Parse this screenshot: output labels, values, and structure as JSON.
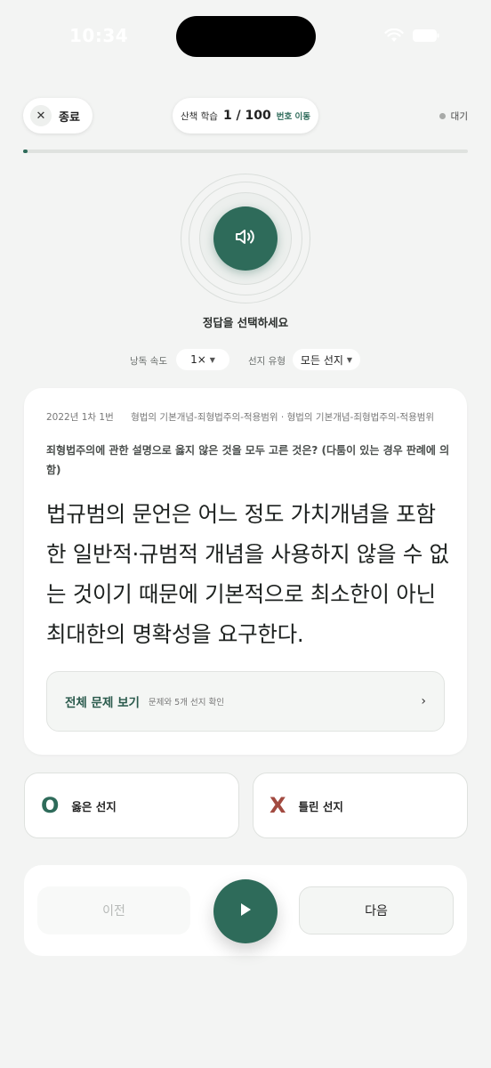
{
  "status_bar": {
    "time": "10:34"
  },
  "header": {
    "exit_label": "종료",
    "mode_label": "산책 학습",
    "counter": "1 / 100",
    "jump_label": "번호 이동",
    "state_label": "대기",
    "progress": 0.01
  },
  "audio": {
    "prompt": "정답을 선택하세요"
  },
  "settings": {
    "speed_label": "낭독 속도",
    "speed_value": "1×",
    "choice_type_label": "선지 유형",
    "choice_type_value": "모든 선지"
  },
  "question_card": {
    "source": "2022년 1차 1번",
    "tags": [
      "형법의 기본개념-죄형법주의-적용범위",
      "형법의 기본개념-죄형법주의-적용범위"
    ],
    "question": "죄형법주의에 관한 설명으로 옳지 않은 것을 모두 고른 것은? (다툼이 있는 경우 판례에 의함)",
    "statement": "법규범의 문언은 어느 정도 가치개념을 포함한 일반적·규범적 개념을 사용하지 않을 수 없는 것이기 때문에 기본적으로 최소한이 아닌 최대한의 명확성을 요구한다.",
    "view_all_title": "전체 문제 보기",
    "view_all_sub": "문제와 5개 선지 확인"
  },
  "answers": {
    "correct": {
      "mark": "O",
      "label": "옳은 선지"
    },
    "wrong": {
      "mark": "X",
      "label": "틀린 선지"
    }
  },
  "nav": {
    "prev_label": "이전",
    "next_label": "다음"
  },
  "colors": {
    "accent": "#2e6b5a",
    "wrong": "#a24a40"
  }
}
